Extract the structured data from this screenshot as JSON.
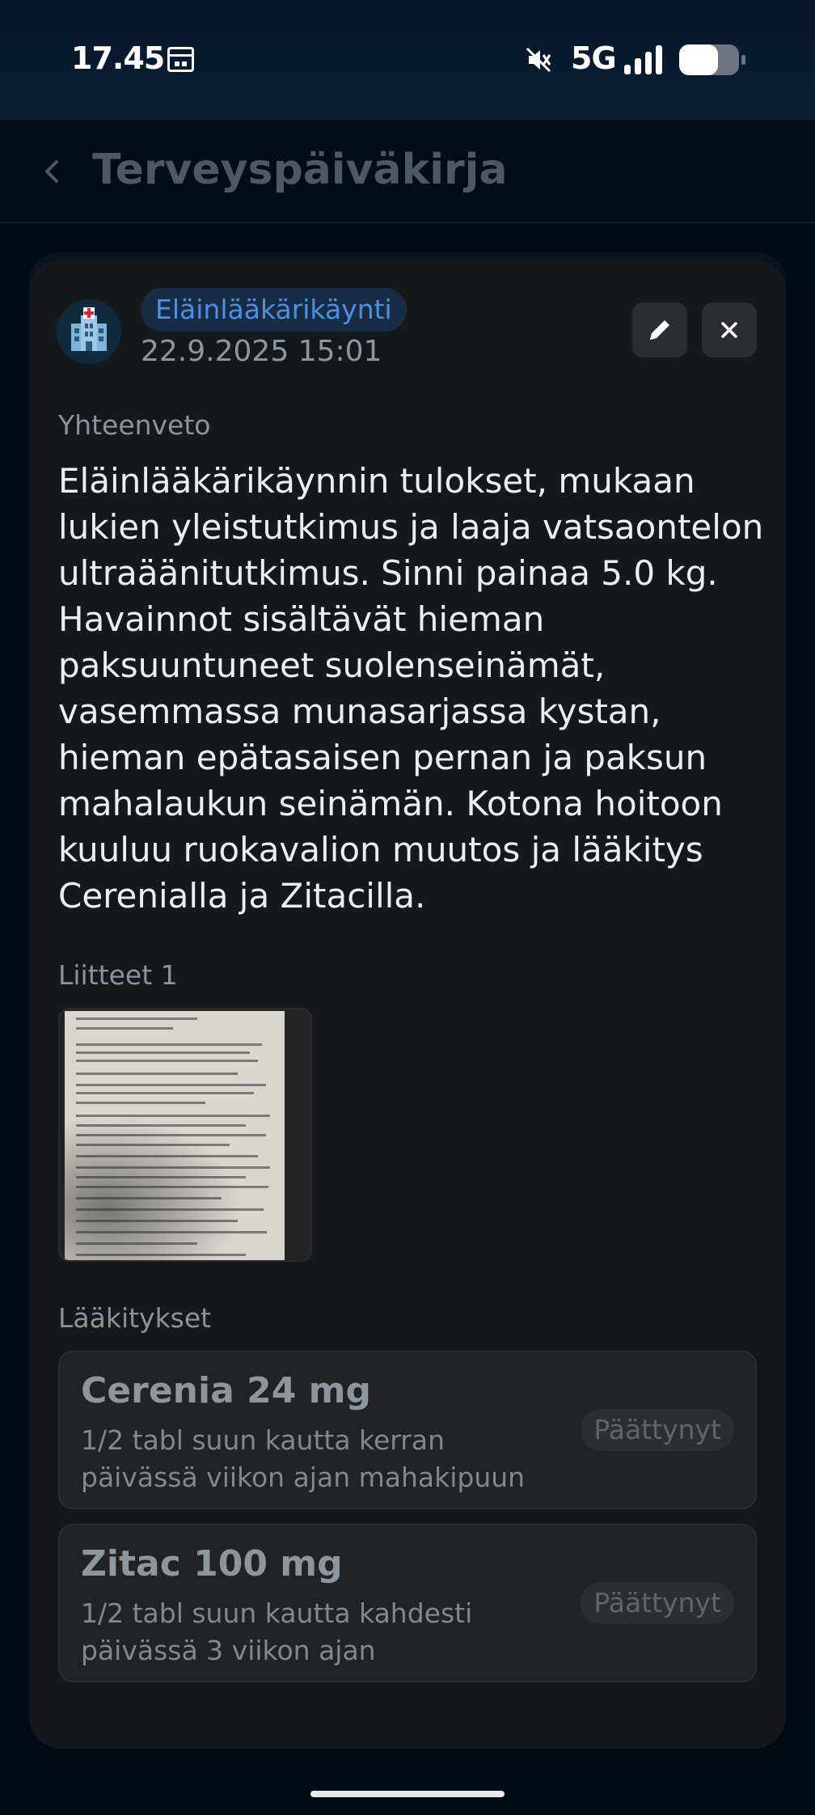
{
  "status_bar": {
    "time": "17.45",
    "network": "5G",
    "icons": [
      "calendar-icon",
      "mute-icon",
      "signal-icon",
      "battery-icon"
    ]
  },
  "header": {
    "title": "Terveyspäiväkirja"
  },
  "entry": {
    "category": "Eläinlääkärikäynti",
    "datetime": "22.9.2025 15:01",
    "summary_label": "Yhteenveto",
    "summary": "Eläinlääkärikäynnin tulokset, mukaan lukien yleistutkimus ja laaja vatsaontelon ultraäänitutkimus. Sinni painaa 5.0 kg. Havainnot sisältävät hieman paksuuntuneet suolenseinämät, vasemmassa munasarjassa kystan, hieman epätasaisen pernan ja paksun mahalaukun seinämän. Kotona hoitoon kuuluu ruokavalion muutos ja lääkitys Cerenialla ja Zitacilla.",
    "attachments_label": "Liitteet 1",
    "medications_label": "Lääkitykset",
    "medications": [
      {
        "name": "Cerenia 24 mg",
        "instructions": "1/2 tabl suun kautta kerran päivässä viikon ajan mahakipuun",
        "status": "Päättynyt"
      },
      {
        "name": "Zitac 100 mg",
        "instructions": "1/2 tabl suun kautta kahdesti päivässä 3 viikon ajan",
        "status": "Päättynyt"
      }
    ]
  },
  "colors": {
    "background": "#020b14",
    "card": "#16191b",
    "accent": "#4f8fe0",
    "badge_bg": "#172c45"
  }
}
